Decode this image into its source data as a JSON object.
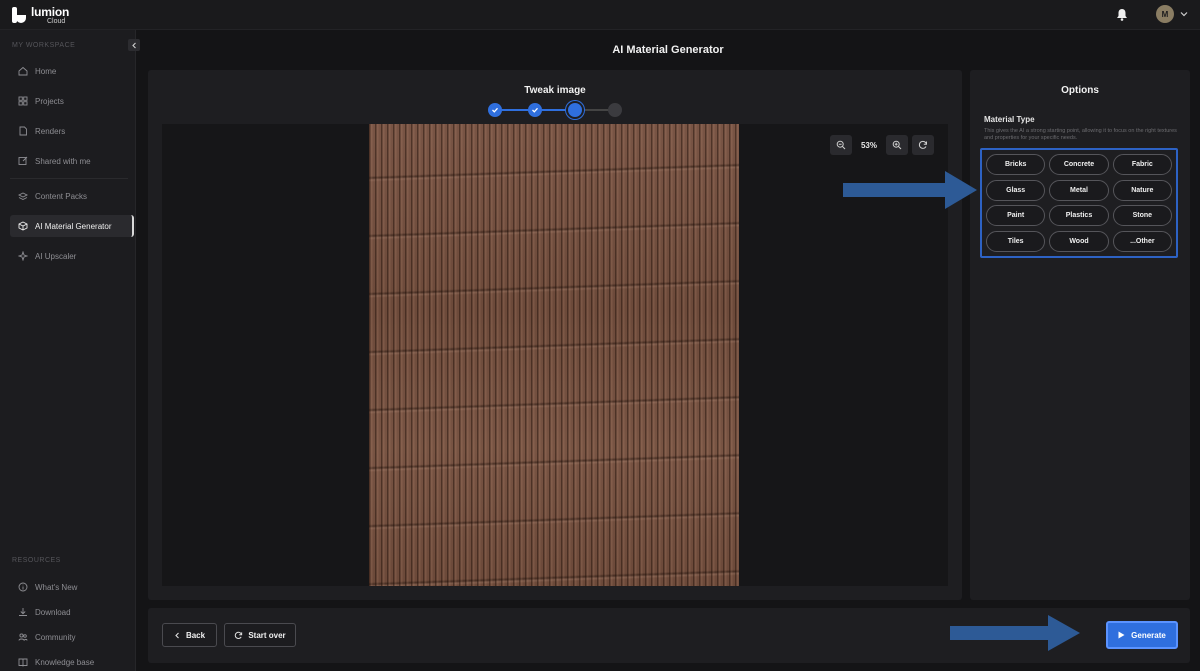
{
  "app": {
    "logo_name": "lumion",
    "logo_sub": "Cloud",
    "user_initial": "M"
  },
  "sidebar": {
    "workspace_label": "MY WORKSPACE",
    "items": [
      {
        "label": "Home",
        "icon": "home-icon"
      },
      {
        "label": "Projects",
        "icon": "grid-icon"
      },
      {
        "label": "Renders",
        "icon": "file-icon"
      },
      {
        "label": "Shared with me",
        "icon": "share-icon"
      },
      {
        "label": "Content Packs",
        "icon": "layers-icon"
      },
      {
        "label": "AI Material Generator",
        "icon": "cube-icon",
        "active": true
      },
      {
        "label": "AI Upscaler",
        "icon": "sparkle-icon"
      }
    ],
    "resources_label": "RESOURCES",
    "resources": [
      {
        "label": "What's New",
        "icon": "info-icon"
      },
      {
        "label": "Download",
        "icon": "download-icon"
      },
      {
        "label": "Community",
        "icon": "community-icon"
      },
      {
        "label": "Knowledge base",
        "icon": "book-icon"
      }
    ]
  },
  "page": {
    "title": "AI Material Generator"
  },
  "canvas": {
    "step_title": "Tweak image",
    "steps_total": 4,
    "steps_completed": 2,
    "current_step": 3,
    "zoom": "53%"
  },
  "options": {
    "title": "Options",
    "material_type_label": "Material Type",
    "material_type_desc": "This gives the AI a strong starting point, allowing it to focus on the right textures and properties for your specific needs.",
    "materials": [
      "Bricks",
      "Concrete",
      "Fabric",
      "Glass",
      "Metal",
      "Nature",
      "Paint",
      "Plastics",
      "Stone",
      "Tiles",
      "Wood",
      "...Other"
    ]
  },
  "footer": {
    "back_label": "Back",
    "start_over_label": "Start over",
    "generate_label": "Generate"
  },
  "colors": {
    "accent": "#2f6fde",
    "annotation": "#2d5a96"
  }
}
